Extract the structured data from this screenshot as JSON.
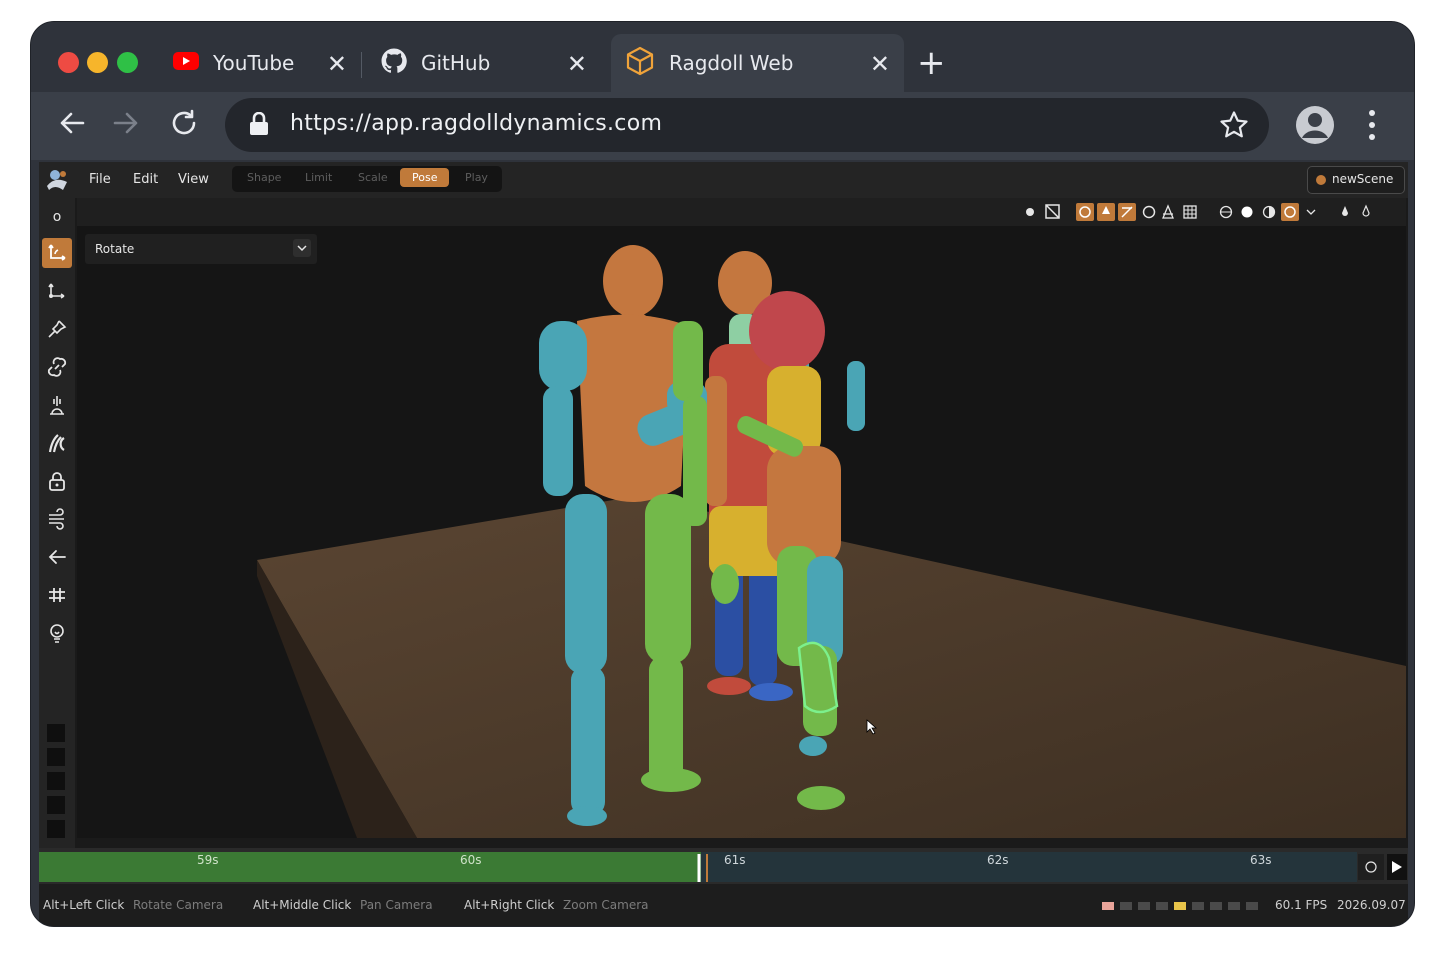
{
  "browser": {
    "tabs": [
      {
        "title": "YouTube",
        "close": "✕"
      },
      {
        "title": "GitHub",
        "close": "✕"
      },
      {
        "title": "Ragdoll Web",
        "close": "✕"
      }
    ],
    "new_tab": "+",
    "url": "https://app.ragdolldynamics.com",
    "colors": {
      "red": "#ee4b43",
      "yellow": "#f6b52b",
      "green": "#2fc046"
    }
  },
  "app": {
    "menu": [
      "File",
      "Edit",
      "View"
    ],
    "modes": [
      "Shape",
      "Limit",
      "Scale",
      "Pose",
      "Play"
    ],
    "active_mode": "Pose",
    "scene_name": "newScene",
    "left_tools_top": "o",
    "dropdown_value": "Rotate",
    "accent": "#c07a3a"
  },
  "timeline": {
    "labels": [
      "59s",
      "60s",
      "61s",
      "62s",
      "63s"
    ],
    "played_color": "#3b7a34"
  },
  "status": {
    "hints": [
      {
        "key": "Alt+Left Click",
        "action": "Rotate Camera"
      },
      {
        "key": "Alt+Middle Click",
        "action": "Pan Camera"
      },
      {
        "key": "Alt+Right Click",
        "action": "Zoom Camera"
      }
    ],
    "fps": "60.1 FPS",
    "version": "2026.09.07"
  }
}
